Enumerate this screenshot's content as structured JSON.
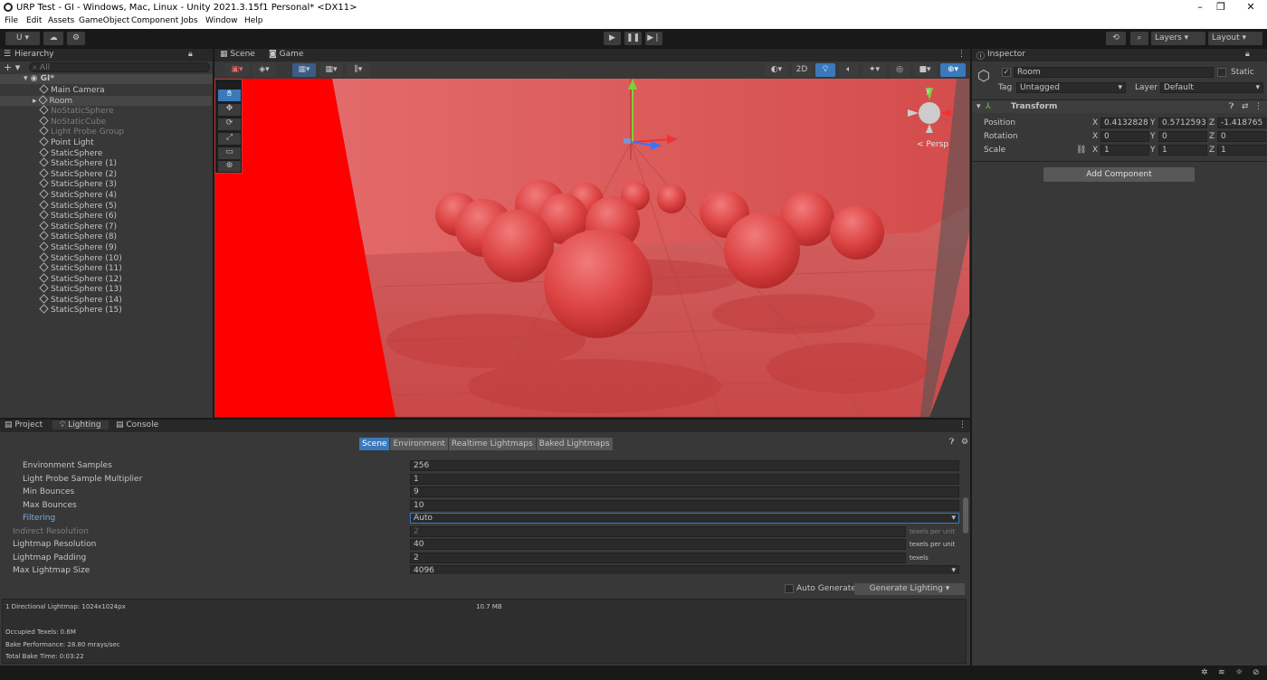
{
  "window": {
    "title": "URP Test - GI - Windows, Mac, Linux - Unity 2021.3.15f1 Personal* <DX11>",
    "minimize": "–",
    "restore": "❐",
    "close": "✕"
  },
  "menu": [
    "File",
    "Edit",
    "Assets",
    "GameObject",
    "Component",
    "Jobs",
    "Window",
    "Help"
  ],
  "toolbar": {
    "account": "U ▾",
    "layers": "Layers",
    "layout": "Layout"
  },
  "hierarchy": {
    "tab": "Hierarchy",
    "search_placeholder": "All",
    "root": "GI*",
    "items": [
      {
        "label": "Main Camera",
        "active": true
      },
      {
        "label": "Room",
        "active": true,
        "selected": true
      },
      {
        "label": "NoStaticSphere",
        "active": false
      },
      {
        "label": "NoStaticCube",
        "active": false
      },
      {
        "label": "Light Probe Group",
        "active": false
      },
      {
        "label": "Point Light",
        "active": true
      },
      {
        "label": "StaticSphere",
        "active": true
      },
      {
        "label": "StaticSphere (1)",
        "active": true
      },
      {
        "label": "StaticSphere (2)",
        "active": true
      },
      {
        "label": "StaticSphere (3)",
        "active": true
      },
      {
        "label": "StaticSphere (4)",
        "active": true
      },
      {
        "label": "StaticSphere (5)",
        "active": true
      },
      {
        "label": "StaticSphere (6)",
        "active": true
      },
      {
        "label": "StaticSphere (7)",
        "active": true
      },
      {
        "label": "StaticSphere (8)",
        "active": true
      },
      {
        "label": "StaticSphere (9)",
        "active": true
      },
      {
        "label": "StaticSphere (10)",
        "active": true
      },
      {
        "label": "StaticSphere (11)",
        "active": true
      },
      {
        "label": "StaticSphere (12)",
        "active": true
      },
      {
        "label": "StaticSphere (13)",
        "active": true
      },
      {
        "label": "StaticSphere (14)",
        "active": true
      },
      {
        "label": "StaticSphere (15)",
        "active": true
      }
    ]
  },
  "scene": {
    "tab_scene": "Scene",
    "tab_game": "Game",
    "btn_2d": "2D",
    "persp": "< Persp",
    "gizmo_y": "y"
  },
  "inspector": {
    "tab": "Inspector",
    "name": "Room",
    "static": "Static",
    "tag_label": "Tag",
    "tag": "Untagged",
    "layer_label": "Layer",
    "layer": "Default",
    "transform": "Transform",
    "position": {
      "label": "Position",
      "x": "0.4132828",
      "y": "0.5712593",
      "z": "-1.418765"
    },
    "rotation": {
      "label": "Rotation",
      "x": "0",
      "y": "0",
      "z": "0"
    },
    "scale": {
      "label": "Scale",
      "x": "1",
      "y": "1",
      "z": "1"
    },
    "add_component": "Add Component"
  },
  "bottom": {
    "tabs": [
      "Project",
      "Lighting",
      "Console"
    ],
    "subtabs": [
      "Scene",
      "Environment",
      "Realtime Lightmaps",
      "Baked Lightmaps"
    ],
    "rows": [
      {
        "label": "Environment Samples",
        "value": "256",
        "indent": true
      },
      {
        "label": "Light Probe Sample Multiplier",
        "value": "1",
        "indent": true
      },
      {
        "label": "Min Bounces",
        "value": "9",
        "indent": true
      },
      {
        "label": "Max Bounces",
        "value": "10",
        "indent": true
      },
      {
        "label": "Filtering",
        "value": "Auto",
        "indent": true,
        "highlight": true
      },
      {
        "label": "Indirect Resolution",
        "value": "2",
        "unit": "texels per unit",
        "disabled": true
      },
      {
        "label": "Lightmap Resolution",
        "value": "40",
        "unit": "texels per unit"
      },
      {
        "label": "Lightmap Padding",
        "value": "2",
        "unit": "texels"
      },
      {
        "label": "Max Lightmap Size",
        "value": "4096"
      }
    ],
    "auto_generate": "Auto Generate",
    "generate": "Generate Lighting",
    "info": {
      "lightmaps": "1 Directional Lightmap: 1024x1024px",
      "size": "10.7 MB",
      "occupied": "Occupied Texels: 0.6M",
      "performance": "Bake Performance: 28.80 mrays/sec",
      "bake_time": "Total Bake Time: 0:03:22"
    }
  },
  "colors": {
    "accent": "#3a79bb",
    "bg": "#383838",
    "room": "#d94d4d"
  }
}
